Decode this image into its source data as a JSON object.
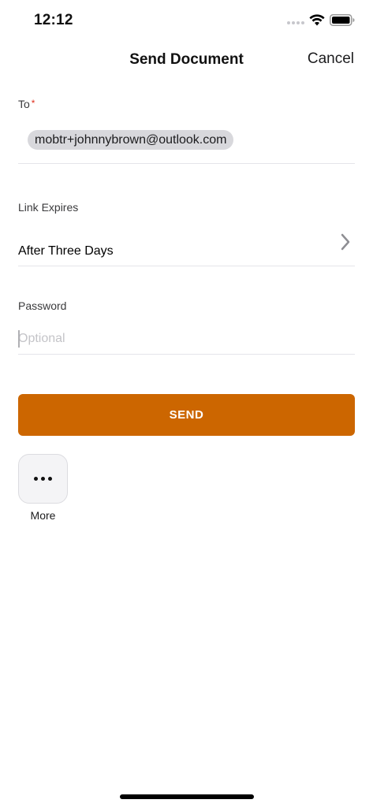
{
  "status_bar": {
    "time": "12:12"
  },
  "nav": {
    "title": "Send Document",
    "cancel_label": "Cancel"
  },
  "form": {
    "to": {
      "label": "To",
      "required_mark": "*",
      "recipients": [
        "mobtr+johnnybrown@outlook.com"
      ]
    },
    "link_expires": {
      "label": "Link Expires",
      "value": "After Three Days"
    },
    "password": {
      "label": "Password",
      "placeholder": "Optional",
      "value": ""
    }
  },
  "actions": {
    "send_label": "SEND",
    "more_label": "More"
  },
  "colors": {
    "accent": "#cc6600",
    "required": "#e0301e",
    "chip": "#d8d8dc"
  },
  "icons": [
    "signal-icon",
    "wifi-icon",
    "battery-icon",
    "chevron-right-icon",
    "more-icon"
  ]
}
